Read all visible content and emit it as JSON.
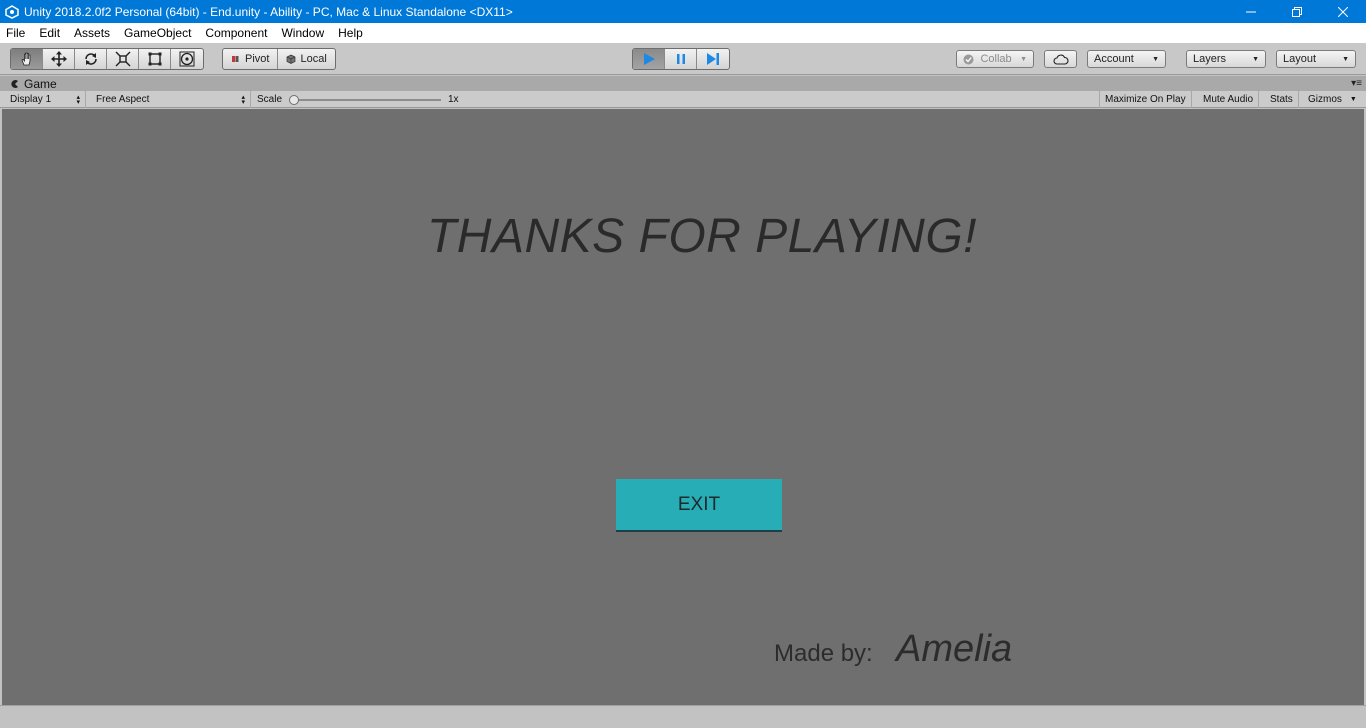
{
  "window": {
    "title": "Unity 2018.2.0f2 Personal (64bit) - End.unity - Ability - PC, Mac & Linux Standalone <DX11>"
  },
  "menu": {
    "items": [
      "File",
      "Edit",
      "Assets",
      "GameObject",
      "Component",
      "Window",
      "Help"
    ]
  },
  "toolbar": {
    "transform_tools": [
      "hand-tool",
      "move-tool",
      "rotate-tool",
      "scale-tool",
      "rect-tool",
      "transform-tool"
    ],
    "active_tool": "hand-tool",
    "pivot_label": "Pivot",
    "local_label": "Local",
    "play_active": true,
    "collab_label": "Collab",
    "account_label": "Account",
    "layers_label": "Layers",
    "layout_label": "Layout"
  },
  "tab": {
    "game_label": "Game"
  },
  "gamebar": {
    "display": "Display 1",
    "aspect": "Free Aspect",
    "scale_label": "Scale",
    "scale_value": "1x",
    "maximize_label": "Maximize On Play",
    "mute_label": "Mute Audio",
    "stats_label": "Stats",
    "gizmos_label": "Gizmos"
  },
  "game": {
    "title": "THANKS FOR PLAYING!",
    "exit_label": "EXIT",
    "madeby_label": "Made by:",
    "author": "Amelia"
  },
  "colors": {
    "titlebar": "#0078d7",
    "game_background": "#6f6f6f",
    "exit_button": "#27adb5"
  }
}
